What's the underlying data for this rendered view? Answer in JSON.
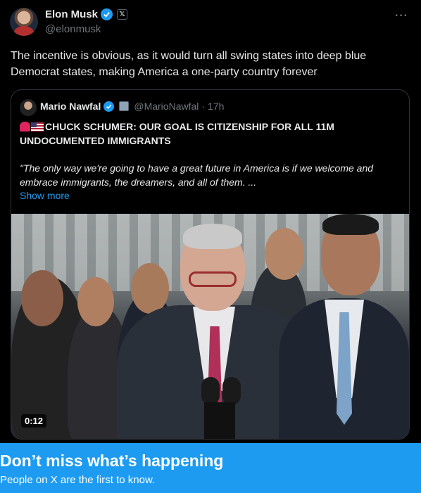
{
  "tweet": {
    "author_name": "Elon Musk",
    "handle": "@elonmusk",
    "more_label": "···",
    "text": "The incentive is obvious, as it would turn all swing states into deep blue Democrat states, making America a one-party country forever"
  },
  "quote": {
    "author_name": "Mario Nawfal",
    "handle": "@MarioNawfal",
    "separator": "·",
    "time": "17h",
    "headline": "CHUCK SCHUMER: OUR GOAL IS CITIZENSHIP FOR ALL 11M UNDOCUMENTED IMMIGRANTS",
    "body": "\"The only way we're going to have a great future in America is if we welcome and embrace immigrants, the dreamers, and all of them. ...",
    "show_more": "Show more",
    "video_duration": "0:12"
  },
  "banner": {
    "title": "Don’t miss what’s happening",
    "subtitle": "People on X are the first to know."
  },
  "colors": {
    "background": "#000000",
    "accent": "#1d9bf0",
    "muted_text": "#71767b",
    "border": "#2f3336"
  },
  "icons": [
    "verified-badge-icon",
    "x-affiliate-icon",
    "more-options-icon",
    "siren-emoji-icon",
    "us-flag-emoji-icon"
  ]
}
